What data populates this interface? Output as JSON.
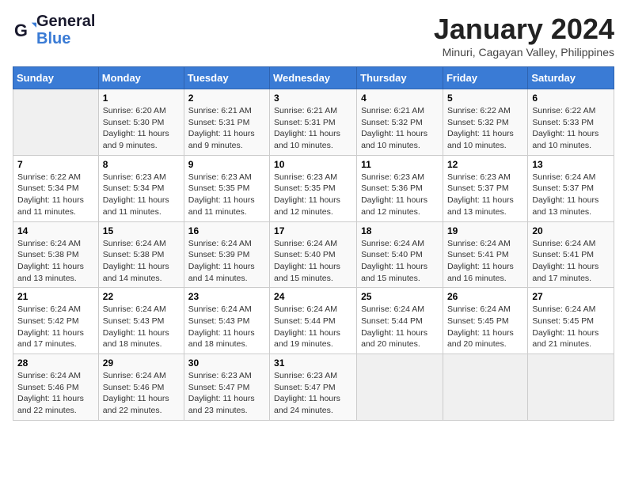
{
  "header": {
    "logo_line1": "General",
    "logo_line2": "Blue",
    "month_title": "January 2024",
    "location": "Minuri, Cagayan Valley, Philippines"
  },
  "weekdays": [
    "Sunday",
    "Monday",
    "Tuesday",
    "Wednesday",
    "Thursday",
    "Friday",
    "Saturday"
  ],
  "weeks": [
    [
      {
        "day": "",
        "info": ""
      },
      {
        "day": "1",
        "info": "Sunrise: 6:20 AM\nSunset: 5:30 PM\nDaylight: 11 hours\nand 9 minutes."
      },
      {
        "day": "2",
        "info": "Sunrise: 6:21 AM\nSunset: 5:31 PM\nDaylight: 11 hours\nand 9 minutes."
      },
      {
        "day": "3",
        "info": "Sunrise: 6:21 AM\nSunset: 5:31 PM\nDaylight: 11 hours\nand 10 minutes."
      },
      {
        "day": "4",
        "info": "Sunrise: 6:21 AM\nSunset: 5:32 PM\nDaylight: 11 hours\nand 10 minutes."
      },
      {
        "day": "5",
        "info": "Sunrise: 6:22 AM\nSunset: 5:32 PM\nDaylight: 11 hours\nand 10 minutes."
      },
      {
        "day": "6",
        "info": "Sunrise: 6:22 AM\nSunset: 5:33 PM\nDaylight: 11 hours\nand 10 minutes."
      }
    ],
    [
      {
        "day": "7",
        "info": "Sunrise: 6:22 AM\nSunset: 5:34 PM\nDaylight: 11 hours\nand 11 minutes."
      },
      {
        "day": "8",
        "info": "Sunrise: 6:23 AM\nSunset: 5:34 PM\nDaylight: 11 hours\nand 11 minutes."
      },
      {
        "day": "9",
        "info": "Sunrise: 6:23 AM\nSunset: 5:35 PM\nDaylight: 11 hours\nand 11 minutes."
      },
      {
        "day": "10",
        "info": "Sunrise: 6:23 AM\nSunset: 5:35 PM\nDaylight: 11 hours\nand 12 minutes."
      },
      {
        "day": "11",
        "info": "Sunrise: 6:23 AM\nSunset: 5:36 PM\nDaylight: 11 hours\nand 12 minutes."
      },
      {
        "day": "12",
        "info": "Sunrise: 6:23 AM\nSunset: 5:37 PM\nDaylight: 11 hours\nand 13 minutes."
      },
      {
        "day": "13",
        "info": "Sunrise: 6:24 AM\nSunset: 5:37 PM\nDaylight: 11 hours\nand 13 minutes."
      }
    ],
    [
      {
        "day": "14",
        "info": "Sunrise: 6:24 AM\nSunset: 5:38 PM\nDaylight: 11 hours\nand 13 minutes."
      },
      {
        "day": "15",
        "info": "Sunrise: 6:24 AM\nSunset: 5:38 PM\nDaylight: 11 hours\nand 14 minutes."
      },
      {
        "day": "16",
        "info": "Sunrise: 6:24 AM\nSunset: 5:39 PM\nDaylight: 11 hours\nand 14 minutes."
      },
      {
        "day": "17",
        "info": "Sunrise: 6:24 AM\nSunset: 5:40 PM\nDaylight: 11 hours\nand 15 minutes."
      },
      {
        "day": "18",
        "info": "Sunrise: 6:24 AM\nSunset: 5:40 PM\nDaylight: 11 hours\nand 15 minutes."
      },
      {
        "day": "19",
        "info": "Sunrise: 6:24 AM\nSunset: 5:41 PM\nDaylight: 11 hours\nand 16 minutes."
      },
      {
        "day": "20",
        "info": "Sunrise: 6:24 AM\nSunset: 5:41 PM\nDaylight: 11 hours\nand 17 minutes."
      }
    ],
    [
      {
        "day": "21",
        "info": "Sunrise: 6:24 AM\nSunset: 5:42 PM\nDaylight: 11 hours\nand 17 minutes."
      },
      {
        "day": "22",
        "info": "Sunrise: 6:24 AM\nSunset: 5:43 PM\nDaylight: 11 hours\nand 18 minutes."
      },
      {
        "day": "23",
        "info": "Sunrise: 6:24 AM\nSunset: 5:43 PM\nDaylight: 11 hours\nand 18 minutes."
      },
      {
        "day": "24",
        "info": "Sunrise: 6:24 AM\nSunset: 5:44 PM\nDaylight: 11 hours\nand 19 minutes."
      },
      {
        "day": "25",
        "info": "Sunrise: 6:24 AM\nSunset: 5:44 PM\nDaylight: 11 hours\nand 20 minutes."
      },
      {
        "day": "26",
        "info": "Sunrise: 6:24 AM\nSunset: 5:45 PM\nDaylight: 11 hours\nand 20 minutes."
      },
      {
        "day": "27",
        "info": "Sunrise: 6:24 AM\nSunset: 5:45 PM\nDaylight: 11 hours\nand 21 minutes."
      }
    ],
    [
      {
        "day": "28",
        "info": "Sunrise: 6:24 AM\nSunset: 5:46 PM\nDaylight: 11 hours\nand 22 minutes."
      },
      {
        "day": "29",
        "info": "Sunrise: 6:24 AM\nSunset: 5:46 PM\nDaylight: 11 hours\nand 22 minutes."
      },
      {
        "day": "30",
        "info": "Sunrise: 6:23 AM\nSunset: 5:47 PM\nDaylight: 11 hours\nand 23 minutes."
      },
      {
        "day": "31",
        "info": "Sunrise: 6:23 AM\nSunset: 5:47 PM\nDaylight: 11 hours\nand 24 minutes."
      },
      {
        "day": "",
        "info": ""
      },
      {
        "day": "",
        "info": ""
      },
      {
        "day": "",
        "info": ""
      }
    ]
  ]
}
